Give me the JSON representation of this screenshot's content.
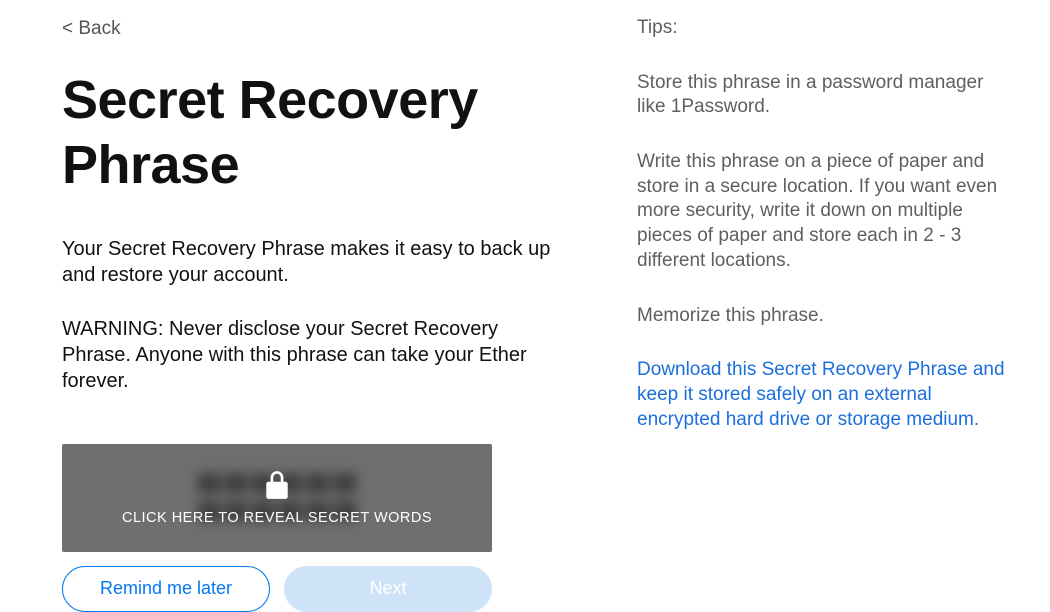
{
  "header": {
    "back_label": "< Back"
  },
  "main": {
    "title": "Secret Recovery Phrase",
    "description": "Your Secret Recovery Phrase makes it easy to back up and restore your account.",
    "warning": "WARNING: Never disclose your Secret Recovery Phrase. Anyone with this phrase can take your Ether forever.",
    "reveal_label": "CLICK HERE TO REVEAL SECRET WORDS"
  },
  "buttons": {
    "remind_label": "Remind me later",
    "next_label": "Next"
  },
  "tips": {
    "heading": "Tips:",
    "tip1": "Store this phrase in a password manager like 1Password.",
    "tip2": "Write this phrase on a piece of paper and store in a secure location. If you want even more security, write it down on multiple pieces of paper and store each in 2 - 3 different locations.",
    "tip3": "Memorize this phrase.",
    "download_text": "Download this Secret Recovery Phrase and keep it stored safely on an external encrypted hard drive or storage medium."
  }
}
